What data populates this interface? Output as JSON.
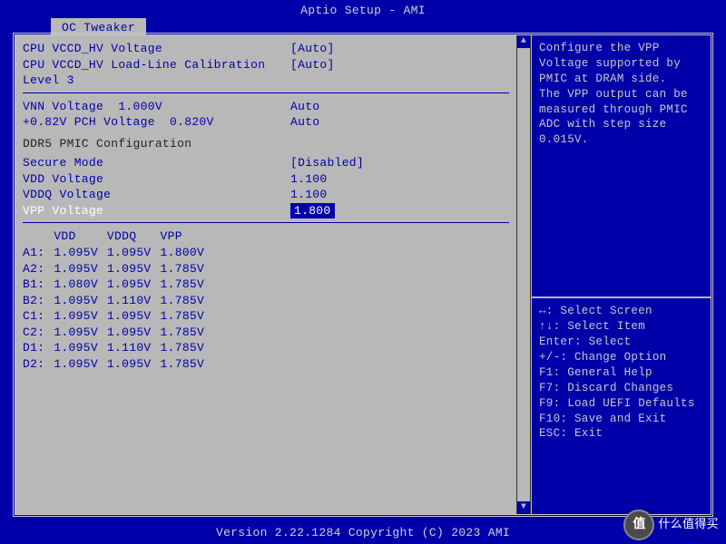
{
  "header": {
    "title": "Aptio Setup - AMI",
    "tab": "OC Tweaker"
  },
  "left": {
    "items": [
      {
        "label": "CPU VCCD_HV Voltage",
        "value": "[Auto]"
      },
      {
        "label": "CPU VCCD_HV Load-Line Calibration",
        "value": "[Auto]"
      },
      {
        "label": "Level 3",
        "value": ""
      }
    ],
    "vnn": {
      "label": "VNN Voltage",
      "reading": "1.000V",
      "value": "Auto"
    },
    "pch": {
      "label": "+0.82V PCH Voltage",
      "reading": "0.820V",
      "value": "Auto"
    },
    "section": "DDR5 PMIC Configuration",
    "pmic": {
      "secure": {
        "label": "Secure Mode",
        "value": "[Disabled]"
      },
      "vdd": {
        "label": "VDD  Voltage",
        "value": "1.100"
      },
      "vddq": {
        "label": "VDDQ Voltage",
        "value": "1.100"
      },
      "vpp": {
        "label": "VPP  Voltage",
        "value": "1.800"
      }
    },
    "table": {
      "headers": [
        "",
        "VDD",
        "VDDQ",
        "VPP"
      ],
      "rows": [
        {
          "ch": "A1:",
          "vdd": "1.095V",
          "vddq": "1.095V",
          "vpp": "1.800V"
        },
        {
          "ch": "A2:",
          "vdd": "1.095V",
          "vddq": "1.095V",
          "vpp": "1.785V"
        },
        {
          "ch": "B1:",
          "vdd": "1.080V",
          "vddq": "1.095V",
          "vpp": "1.785V"
        },
        {
          "ch": "B2:",
          "vdd": "1.095V",
          "vddq": "1.110V",
          "vpp": "1.785V"
        },
        {
          "ch": "C1:",
          "vdd": "1.095V",
          "vddq": "1.095V",
          "vpp": "1.785V"
        },
        {
          "ch": "C2:",
          "vdd": "1.095V",
          "vddq": "1.095V",
          "vpp": "1.785V"
        },
        {
          "ch": "D1:",
          "vdd": "1.095V",
          "vddq": "1.110V",
          "vpp": "1.785V"
        },
        {
          "ch": "D2:",
          "vdd": "1.095V",
          "vddq": "1.095V",
          "vpp": "1.785V"
        }
      ]
    }
  },
  "help": {
    "l1": "Configure the VPP",
    "l2": "Voltage supported by",
    "l3": "PMIC at DRAM side.",
    "l4": "The VPP output can be",
    "l5": "measured through PMIC",
    "l6": "ADC with step size",
    "l7": "0.015V."
  },
  "keys": {
    "k1": "↔: Select Screen",
    "k2": "↑↓: Select Item",
    "k3": "Enter: Select",
    "k4": "+/-: Change Option",
    "k5": "F1: General Help",
    "k6": "F7: Discard Changes",
    "k7": "F9: Load UEFI Defaults",
    "k8": "F10: Save and Exit",
    "k9": "ESC: Exit"
  },
  "footer": {
    "text": "Version 2.22.1284 Copyright (C) 2023 AMI"
  },
  "watermark": {
    "badge": "值",
    "text": "什么值得买"
  }
}
